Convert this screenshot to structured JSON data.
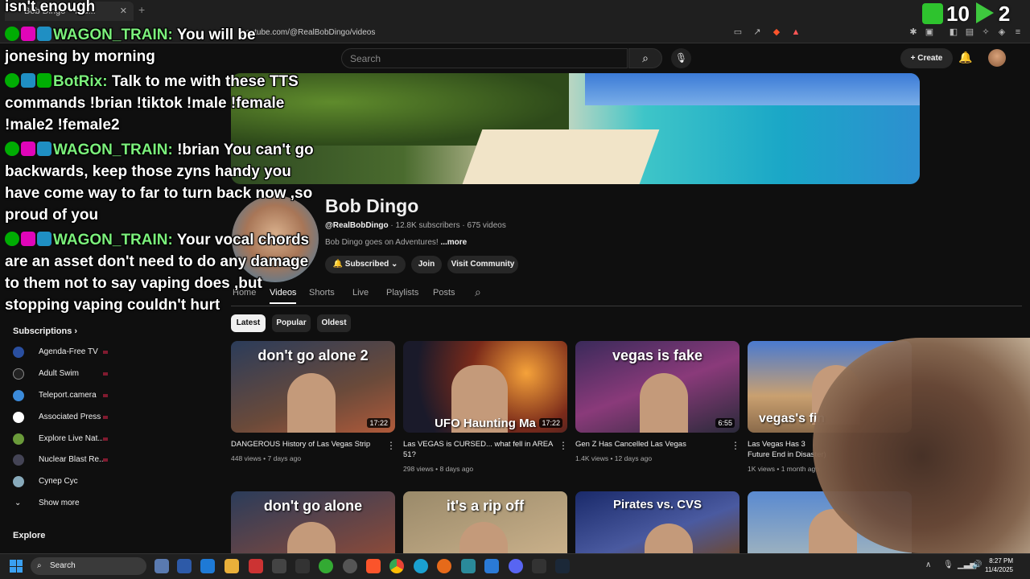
{
  "browser": {
    "tab_title": "Bob Dingo - You...",
    "url": "youtube.com/@RealBobDingo/videos"
  },
  "header": {
    "search_placeholder": "Search",
    "create_label": "Create"
  },
  "channel": {
    "name": "Bob Dingo",
    "handle": "@RealBobDingo",
    "stats": "· 12.8K subscribers · 675 videos",
    "description": "Bob Dingo goes on Adventures!",
    "more": "...more",
    "subscribed_label": "Subscribed",
    "join_label": "Join",
    "community_label": "Visit Community"
  },
  "tabs": [
    "Home",
    "Videos",
    "Shorts",
    "Live",
    "Playlists",
    "Posts"
  ],
  "chips": [
    "Latest",
    "Popular",
    "Oldest"
  ],
  "sidebar": {
    "subscriptions_label": "Subscriptions",
    "subs": [
      "Agenda-Free TV",
      "Adult Swim",
      "Teleport.camera",
      "Associated Press",
      "Explore Live Nat...",
      "Nuclear Blast Re...",
      "Супер Сус"
    ],
    "show_more": "Show more",
    "explore": "Explore"
  },
  "videos": [
    {
      "thumb_text": "don't go alone 2",
      "duration": "17:22",
      "title": "DANGEROUS History of Las Vegas Strip",
      "meta": "448 views • 7 days ago"
    },
    {
      "thumb_text": "UFO  Haunting  Ma",
      "duration": "17:22",
      "title": "Las VEGAS is CURSED... what fell in AREA 51?",
      "meta": "298 views • 8 days ago"
    },
    {
      "thumb_text": "vegas is fake",
      "duration": "6:55",
      "title": "Gen Z Has Cancelled Las Vegas",
      "meta": "1.4K views • 12 days ago"
    },
    {
      "thumb_text": "vegas's fin",
      "duration": "",
      "title": "Las Vegas Has 3 Future End in Disaster)",
      "meta": "1K views • 1 month ago"
    }
  ],
  "videos_row2": [
    "don't go alone",
    "it's a rip off",
    "Pirates vs. CVS",
    ""
  ],
  "chat": {
    "top_fragment": "isn't enough",
    "messages": [
      {
        "user": "WAGON_TRAIN:",
        "text": "You will be jonesing by morning"
      },
      {
        "user": "BotRix:",
        "text": "Talk to me with these TTS commands !brian !tiktok !male !female !male2 !female2"
      },
      {
        "user": "WAGON_TRAIN:",
        "text": "!brian You can't go backwards, keep those zyns handy you have come way to far to turn back now ,so proud of you"
      },
      {
        "user": "WAGON_TRAIN:",
        "text": "Your vocal chords are an asset don't need to do any damage to them not to say vaping does ,but stopping vaping couldn't hurt"
      }
    ]
  },
  "counters": {
    "kick": "10",
    "play": "2"
  },
  "taskbar": {
    "search_label": "Search",
    "time": "8:27 PM",
    "date": "11/4/2025"
  }
}
